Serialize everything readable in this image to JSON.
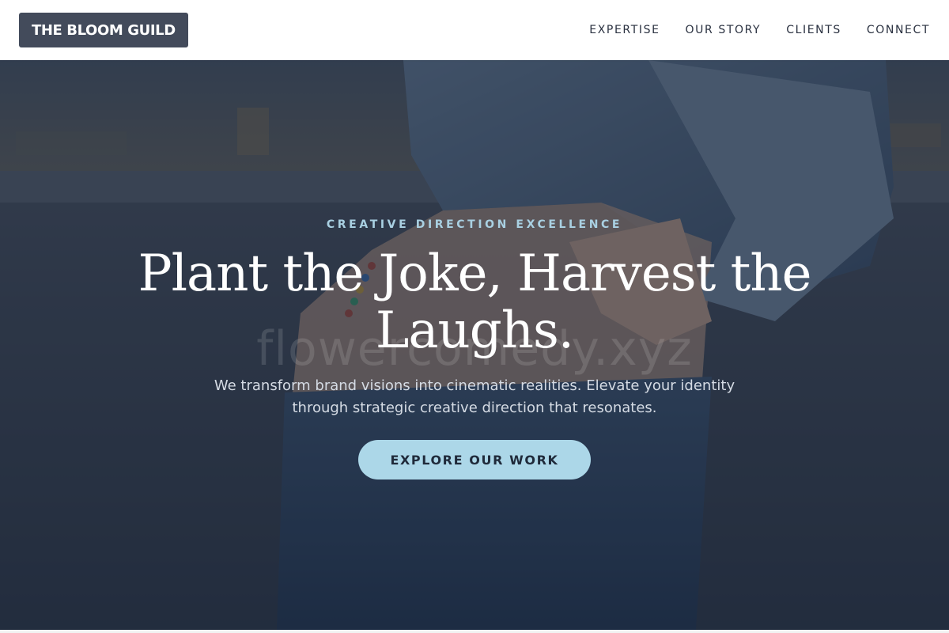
{
  "brand": {
    "logo_text": "THE BLOOM GUILD"
  },
  "nav": {
    "items": [
      {
        "label": "EXPERTISE"
      },
      {
        "label": "OUR STORY"
      },
      {
        "label": "CLIENTS"
      },
      {
        "label": "CONNECT"
      }
    ]
  },
  "hero": {
    "eyebrow": "CREATIVE DIRECTION EXCELLENCE",
    "headline": "Plant the Joke, Harvest the Laughs.",
    "subtext": "We transform brand visions into cinematic realities. Elevate your identity through strategic creative direction that resonates.",
    "cta_label": "EXPLORE OUR WORK",
    "watermark_text": "flowercomedy.xyz",
    "background_image": "person in cropped denim jacket and jeans against concrete wall"
  },
  "colors": {
    "logo_bg": "#434b5b",
    "nav_text": "#2a3140",
    "eyebrow": "#a9d0e2",
    "cta_bg": "#acd7e8",
    "cta_text": "#1f2a3a",
    "hero_overlay": "#1c2638"
  }
}
